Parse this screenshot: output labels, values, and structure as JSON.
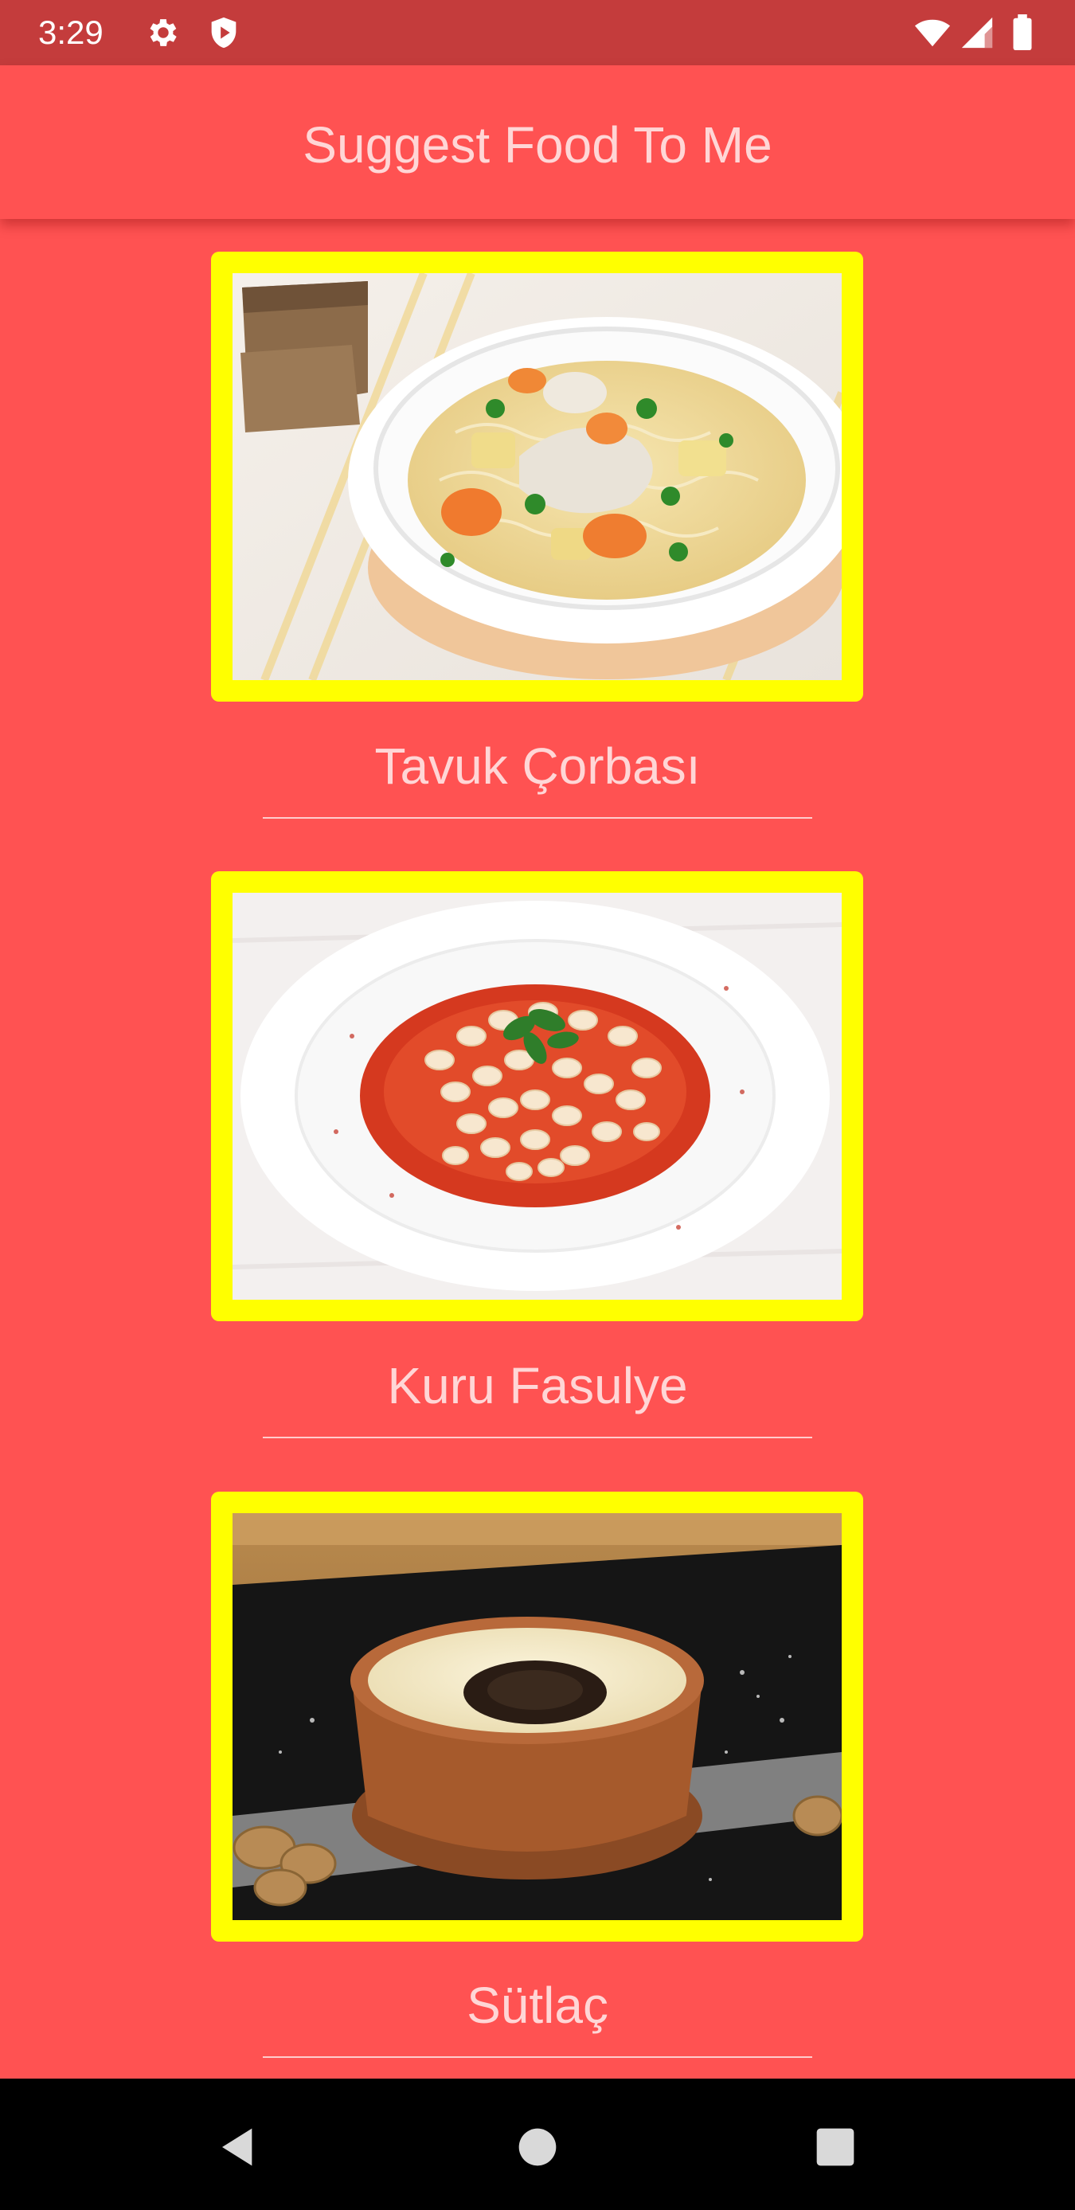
{
  "status_bar": {
    "time": "3:29",
    "icons": [
      "gear-icon",
      "shield-play-icon",
      "wifi-icon",
      "cellular-signal-icon",
      "battery-icon"
    ]
  },
  "app_bar": {
    "title": "Suggest Food To Me"
  },
  "foods": [
    {
      "name": "Tavuk Çorbası",
      "photo": "chicken-noodle-soup-photo"
    },
    {
      "name": "Kuru Fasulye",
      "photo": "white-bean-stew-photo"
    },
    {
      "name": "Sütlaç",
      "photo": "rice-pudding-photo"
    }
  ],
  "colors": {
    "background": "#ff5252",
    "status_bar": "#c43c3c",
    "frame": "#ffff00",
    "text": "#ffd6d6",
    "nav_bar": "#000000"
  },
  "nav_bar": {
    "buttons": [
      "back-icon",
      "home-icon",
      "recents-icon"
    ]
  }
}
